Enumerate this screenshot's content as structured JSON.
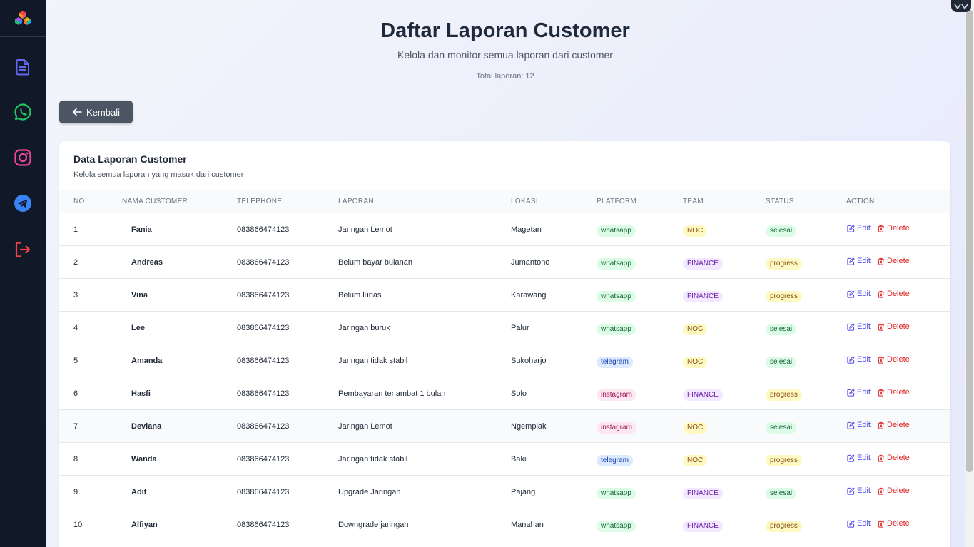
{
  "header": {
    "title": "Daftar Laporan Customer",
    "subtitle": "Kelola dan monitor semua laporan dari customer",
    "total": "Total laporan: 12"
  },
  "back_button": {
    "label": "Kembali"
  },
  "card": {
    "title": "Data Laporan Customer",
    "subtitle": "Kelola semua laporan yang masuk dari customer"
  },
  "table": {
    "columns": [
      "NO",
      "NAMA CUSTOMER",
      "TELEPHONE",
      "LAPORAN",
      "LOKASI",
      "PLATFORM",
      "TEAM",
      "STATUS",
      "ACTION"
    ],
    "rows": [
      {
        "no": "1",
        "name": "Fania",
        "phone": "083866474123",
        "report": "Jaringan Lemot",
        "location": "Magetan",
        "platform": "whatsapp",
        "team": "NOC",
        "status": "selesai"
      },
      {
        "no": "2",
        "name": "Andreas",
        "phone": "083866474123",
        "report": "Belum bayar bulanan",
        "location": "Jumantono",
        "platform": "whatsapp",
        "team": "FINANCE",
        "status": "progress"
      },
      {
        "no": "3",
        "name": "Vina",
        "phone": "083866474123",
        "report": "Belum lunas",
        "location": "Karawang",
        "platform": "whatsapp",
        "team": "FINANCE",
        "status": "progress"
      },
      {
        "no": "4",
        "name": "Lee",
        "phone": "083866474123",
        "report": "Jaringan buruk",
        "location": "Palur",
        "platform": "whatsapp",
        "team": "NOC",
        "status": "selesai"
      },
      {
        "no": "5",
        "name": "Amanda",
        "phone": "083866474123",
        "report": "Jaringan tidak stabil",
        "location": "Sukoharjo",
        "platform": "telegram",
        "team": "NOC",
        "status": "selesai"
      },
      {
        "no": "6",
        "name": "Hasfi",
        "phone": "083866474123",
        "report": "Pembayaran terlambat 1 bulan",
        "location": "Solo",
        "platform": "instagram",
        "team": "FINANCE",
        "status": "progress"
      },
      {
        "no": "7",
        "name": "Deviana",
        "phone": "083866474123",
        "report": "Jaringan Lemot",
        "location": "Ngemplak",
        "platform": "instagram",
        "team": "NOC",
        "status": "selesai"
      },
      {
        "no": "8",
        "name": "Wanda",
        "phone": "083866474123",
        "report": "Jaringan tidak stabil",
        "location": "Baki",
        "platform": "telegram",
        "team": "NOC",
        "status": "progress"
      },
      {
        "no": "9",
        "name": "Adit",
        "phone": "083866474123",
        "report": "Upgrade Jaringan",
        "location": "Pajang",
        "platform": "whatsapp",
        "team": "FINANCE",
        "status": "selesai"
      },
      {
        "no": "10",
        "name": "Alfiyan",
        "phone": "083866474123",
        "report": "Downgrade jaringan",
        "location": "Manahan",
        "platform": "whatsapp",
        "team": "FINANCE",
        "status": "progress"
      }
    ],
    "edit_label": "Edit",
    "delete_label": "Delete"
  },
  "sidebar": {
    "icons": [
      "document-icon",
      "whatsapp-icon",
      "instagram-icon",
      "telegram-icon",
      "logout-icon"
    ]
  },
  "colors": {
    "sidebar": "#111827",
    "accent": "#4f46e5",
    "danger": "#dc2626"
  }
}
